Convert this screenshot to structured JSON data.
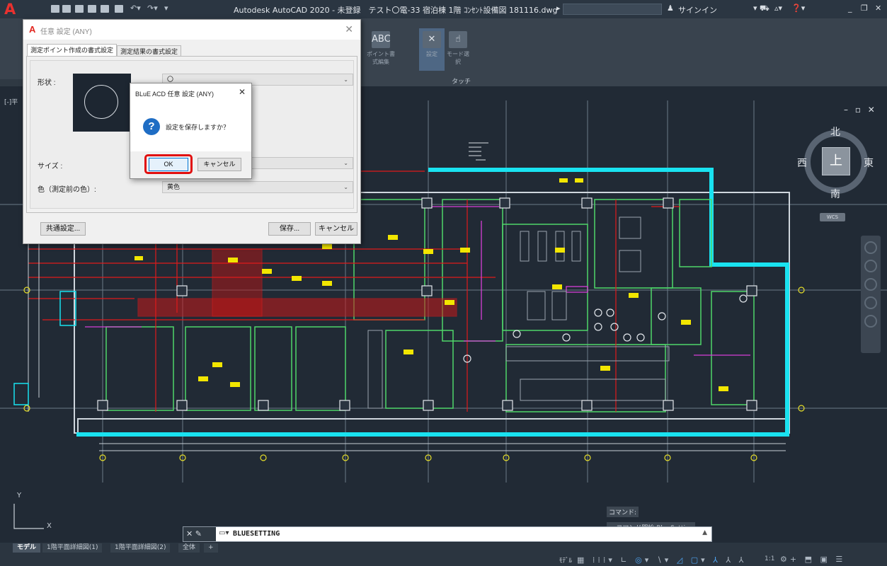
{
  "window": {
    "title": "Autodesk AutoCAD 2020 - 未登録　テスト〇電-33 宿泊棟 1階 ｺﾝｾﾝﾄ設備図 181116.dwg",
    "signin": "サインイン",
    "app_logo": "A"
  },
  "ribbon": {
    "buttons": [
      {
        "label": "ポイント書式編集",
        "icon": "ABC"
      },
      {
        "label": "設定",
        "icon": "✕"
      },
      {
        "label": "モード選択",
        "icon": "☝"
      }
    ],
    "panel_label": "タッチ"
  },
  "viewport": {
    "label": "[-]平",
    "controls": "– ▫ ✕",
    "compass": {
      "north": "北",
      "south": "南",
      "west": "西",
      "east": "東",
      "top": "上",
      "wcs": "WCS"
    }
  },
  "ucs": {
    "x": "X",
    "y": "Y"
  },
  "command": {
    "history": [
      "コマンド:",
      "> コマンド開始 BlueSetting"
    ],
    "input": "BLUESETTING"
  },
  "layout_tabs": [
    "モデル",
    "1階平面詳細図(1)",
    "1階平面詳細図(2)",
    "全体",
    "+"
  ],
  "statusbar": {
    "model": "ﾓﾃﾞﾙ",
    "scale": "1:1"
  },
  "dialog_main": {
    "title": "任意 設定 (ANY)",
    "tabs": [
      "測定ポイント作成の書式設定",
      "測定結果の書式設定"
    ],
    "shape_label": "形状 :",
    "shape_value": "〇",
    "size_label": "サイズ :",
    "color_label": "色（測定前の色）:",
    "color_value": "黄色",
    "common_button": "共通設定...",
    "save_button": "保存...",
    "cancel_button": "キャンセル"
  },
  "dialog_confirm": {
    "title": "BLuE ACD 任意 設定 (ANY)",
    "message": "設定を保存しますか？",
    "ok": "OK",
    "cancel": "キャンセル",
    "icon": "?"
  },
  "colors": {
    "accent_cyan": "#19e2f0",
    "wall_red": "#e01b1b",
    "highlight_red": "#e10e0e",
    "canvas": "#212a35"
  }
}
